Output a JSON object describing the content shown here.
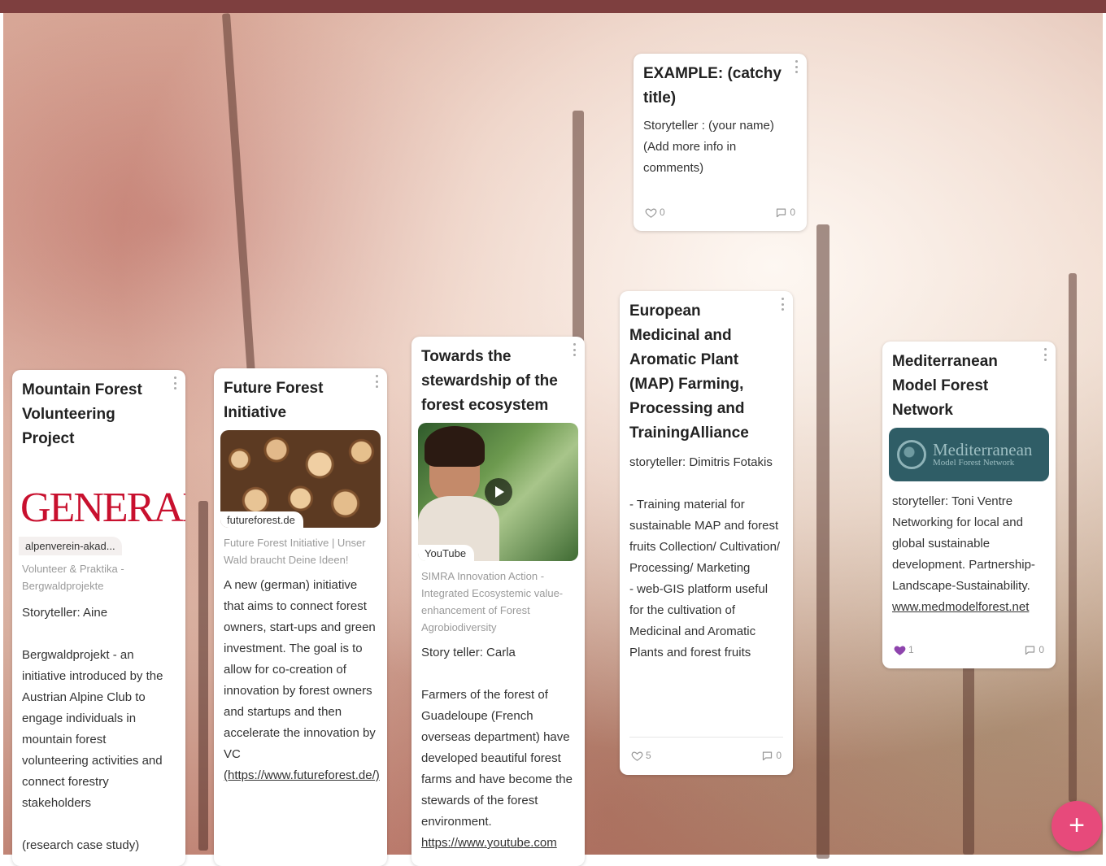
{
  "colors": {
    "topbar": "#7e3f3f",
    "fab": "#e74a7b",
    "liked_heart": "#8e44ad"
  },
  "cards": {
    "mountain": {
      "title": "Mountain Forest Volunteering Project",
      "preview_logo": "GENERAI",
      "preview_source": "alpenverein-akad...",
      "preview_caption": "Volunteer & Praktika - Bergwaldprojekte",
      "body": "Storyteller: Aine\n\nBergwaldprojekt - an initiative introduced by the Austrian Alpine Club to engage individuals in mountain forest volunteering activities and connect forestry stakeholders\n\n(research case study)"
    },
    "future": {
      "title": "Future Forest Initiative",
      "preview_source": "futureforest.de",
      "preview_caption": "Future Forest Initiative | Unser Wald braucht Deine Ideen!",
      "body": "A new (german) initiative that aims to connect forest owners, start-ups and green investment. The goal is to allow for co-creation of innovation by forest owners and startups and then accelerate the innovation by VC",
      "link": "(https://www.futureforest.de/)"
    },
    "towards": {
      "title": "Towards the stewardship of the forest ecosystem",
      "preview_source": "YouTube",
      "preview_caption": "SIMRA Innovation Action - Integrated Ecosystemic value-enhancement of Forest Agrobiodiversity",
      "body": "Story teller: Carla\n\nFarmers of the forest of Guadeloupe (French overseas department) have developed beautiful forest farms and have become the stewards of the forest environment.",
      "link": "https://www.youtube.com"
    },
    "example": {
      "title": "EXAMPLE: (catchy title)",
      "body": "Storyteller : (your name)\n(Add more info in comments)",
      "likes": "0",
      "comments": "0"
    },
    "european": {
      "title": "European Medicinal and Aromatic Plant (MAP) Farming, Processing and TrainingAlliance",
      "body": "storyteller:  Dimitris Fotakis\n\n- Training material for sustainable MAP and forest fruits Collection/ Cultivation/ Processing/ Marketing\n- web-GIS platform useful for the cultivation of Medicinal and Aromatic Plants  and forest fruits",
      "likes": "5",
      "comments": "0"
    },
    "mediterranean": {
      "title": "Mediterranean Model Forest Network",
      "logo_title": "Mediterranean",
      "logo_subtitle": "Model Forest Network",
      "body": "storyteller: Toni Ventre\nNetworking for local and global sustainable development. Partnership-Landscape-Sustainability.",
      "link": "www.medmodelforest.net",
      "likes": "1",
      "comments": "0"
    }
  },
  "icons": {
    "menu": "more-vertical-icon",
    "like": "heart-icon",
    "comment": "comment-icon",
    "play": "play-icon",
    "add": "plus-icon"
  },
  "fab_label": "+"
}
